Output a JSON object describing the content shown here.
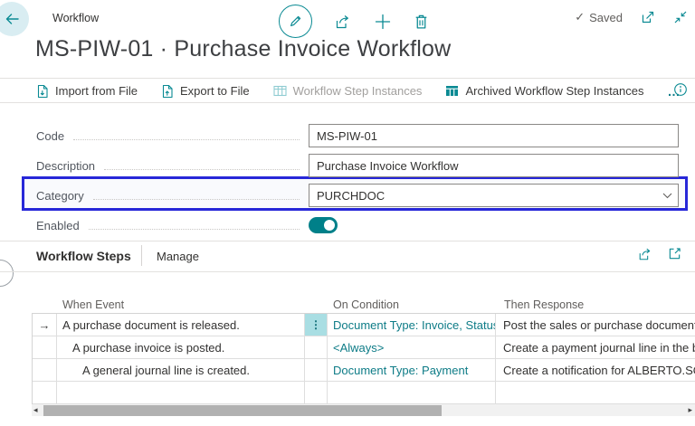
{
  "topbar": {
    "caption": "Workflow",
    "saved": "Saved"
  },
  "page": {
    "title": "MS-PIW-01 · Purchase Invoice Workflow"
  },
  "action_bar": {
    "items": [
      {
        "label": "Import from File"
      },
      {
        "label": "Export to File"
      },
      {
        "label": "Workflow Step Instances"
      },
      {
        "label": "Archived Workflow Step Instances"
      }
    ],
    "more": "…"
  },
  "form": {
    "fields": [
      {
        "label": "Code",
        "value": "MS-PIW-01"
      },
      {
        "label": "Description",
        "value": "Purchase Invoice Workflow"
      },
      {
        "label": "Category",
        "value": "PURCHDOC"
      },
      {
        "label": "Enabled",
        "value": "On"
      }
    ]
  },
  "section": {
    "title": "Workflow Steps",
    "menu": "Manage"
  },
  "grid": {
    "columns": [
      "When Event",
      "On Condition",
      "Then Response"
    ],
    "rows": [
      {
        "when": "A purchase document is released.",
        "condition": "Document Type: Invoice, Status: ...",
        "response": "Post the sales or purchase document",
        "selected": true
      },
      {
        "when": "A purchase invoice is posted.",
        "condition": "<Always>",
        "response": "Create a payment journal line in the b",
        "selected": false
      },
      {
        "when": "A general journal line is created.",
        "condition": "Document Type: Payment",
        "response": "Create a notification for ALBERTO.SOE",
        "selected": false
      }
    ]
  },
  "icons": {
    "check": "✓",
    "row_selector_arrow": "→",
    "vertical_ellipsis": "⋮",
    "scroll_left": "◂",
    "scroll_right": "▸"
  },
  "colors": {
    "accent_teal": "#0a8a93",
    "link_teal": "#0e7c87",
    "highlight_blue": "#2727d8",
    "selected_cell_bg": "#a9dee3",
    "toggle_on": "#008089"
  }
}
